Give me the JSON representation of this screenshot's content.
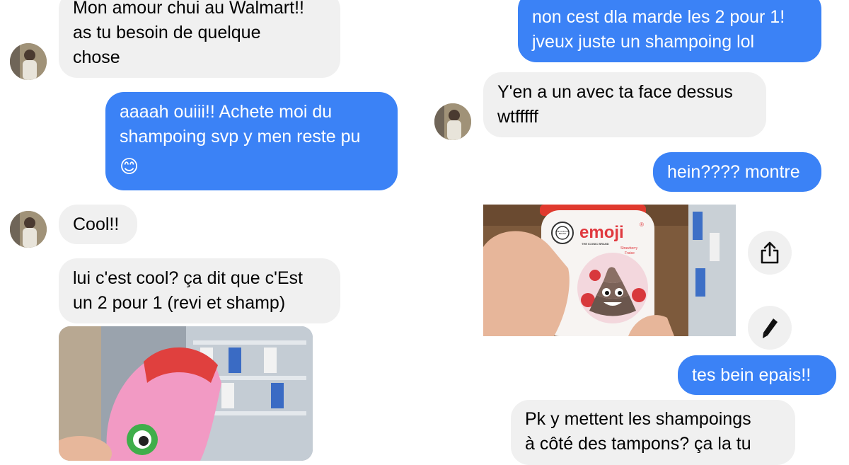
{
  "left_column": {
    "messages": [
      {
        "sender": "contact",
        "lines": [
          "Mon amour chui au Walmart!!",
          "as tu besoin de quelque",
          "chose"
        ]
      },
      {
        "sender": "me",
        "lines": [
          "aaaah ouiii!! Achete moi du",
          "shampoing svp y men reste pu"
        ],
        "emoji": "😊"
      },
      {
        "sender": "contact",
        "lines": [
          "Cool!!"
        ]
      },
      {
        "sender": "contact",
        "lines": [
          "lui c'est cool? ça dit que c'Est",
          "un 2 pour 1 (revi et shamp)"
        ]
      }
    ],
    "photo": {
      "description_icon": "shampoo-bottle-photo"
    }
  },
  "right_column": {
    "messages": [
      {
        "sender": "me",
        "lines": [
          "non cest dla marde les 2 pour 1!",
          "jveux juste un shampoing lol"
        ]
      },
      {
        "sender": "contact",
        "lines": [
          "Y'en a un avec ta face dessus",
          "wtfffff"
        ]
      },
      {
        "sender": "me",
        "lines": [
          "hein???? montre"
        ]
      },
      {
        "sender": "me",
        "lines": [
          "tes bein epais!!"
        ]
      },
      {
        "sender": "contact",
        "lines": [
          "Pk y mettent les shampoings",
          "à côté des tampons? ça la tu"
        ]
      }
    ],
    "photo": {
      "brand": "emoji",
      "brand_mark": "®",
      "tagline": "THE ICONIC BRAND",
      "flavor_en": "Strawberry",
      "flavor_fr": "Fraise",
      "seal": "THE OFFICIAL BRAND"
    },
    "actions": {
      "share_icon": "share-icon",
      "edit_icon": "pencil-icon"
    }
  },
  "colors": {
    "outgoing": "#3b82f6",
    "incoming": "#f0f0f0",
    "background": "#ffffff"
  }
}
